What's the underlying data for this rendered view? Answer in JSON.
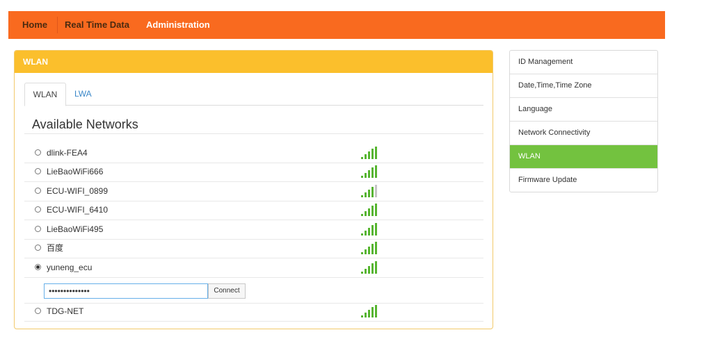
{
  "nav": {
    "items": [
      {
        "label": "Home"
      },
      {
        "label": "Real Time Data"
      },
      {
        "label": "Administration"
      }
    ]
  },
  "panel": {
    "title": "WLAN",
    "tabs": [
      {
        "label": "WLAN"
      },
      {
        "label": "LWA"
      }
    ],
    "section_title": "Available Networks",
    "networks": [
      {
        "ssid": "dlink-FEA4",
        "signal": 4,
        "selected": false
      },
      {
        "ssid": "LieBaoWiFi666",
        "signal": 4,
        "selected": false
      },
      {
        "ssid": "ECU-WIFI_0899",
        "signal": 3,
        "selected": false
      },
      {
        "ssid": "ECU-WIFI_6410",
        "signal": 4,
        "selected": false
      },
      {
        "ssid": "LieBaoWiFi495",
        "signal": 4,
        "selected": false
      },
      {
        "ssid": "百度",
        "signal": 4,
        "selected": false
      },
      {
        "ssid": "yuneng_ecu",
        "signal": 4,
        "selected": true
      },
      {
        "ssid": "TDG-NET",
        "signal": 4,
        "selected": false
      }
    ],
    "password_value": "••••••••••••••",
    "connect_label": "Connect"
  },
  "sidebar": {
    "items": [
      {
        "label": "ID Management"
      },
      {
        "label": "Date,Time,Time Zone"
      },
      {
        "label": "Language"
      },
      {
        "label": "Network Connectivity"
      },
      {
        "label": "WLAN"
      },
      {
        "label": "Firmware Update"
      }
    ]
  },
  "colors": {
    "nav_bg": "#f96a1f",
    "panel_header": "#fbbf2c",
    "active_sidebar": "#73c23f",
    "signal": "#57b531"
  }
}
